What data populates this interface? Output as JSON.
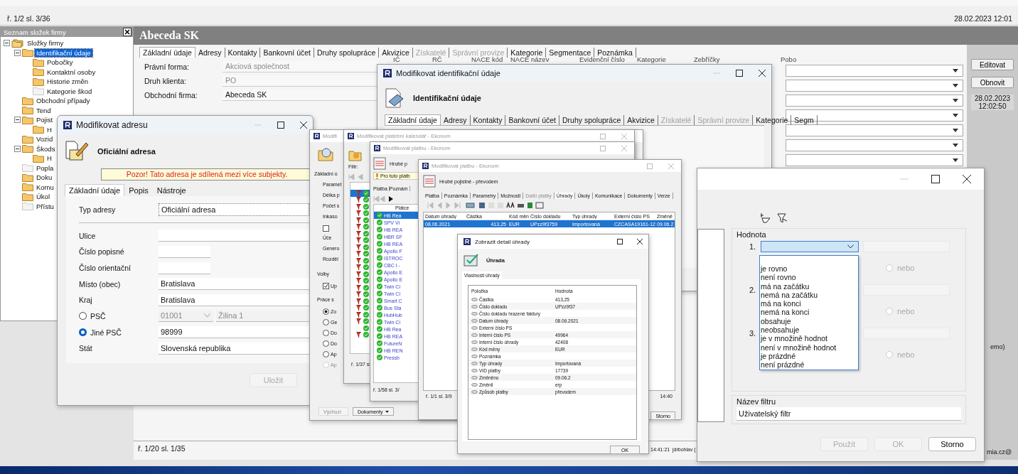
{
  "topbar": {
    "status": "ř. 1/2 sl. 3/36",
    "datetime": "28.02.2023 12:01"
  },
  "folder_panel": {
    "title": "Seznam složek firmy",
    "tree": [
      {
        "label": "Složky firmy",
        "kind": "root",
        "selected": false,
        "expanded": true,
        "children": [
          {
            "label": "Identifikační údaje",
            "kind": "folder",
            "selected": true,
            "expanded": true,
            "children": [
              {
                "label": "Pobočky",
                "kind": "folder",
                "selected": false
              },
              {
                "label": "Kontaktní osoby",
                "kind": "folder",
                "selected": false
              },
              {
                "label": "Historie změn",
                "kind": "folder",
                "selected": false
              },
              {
                "label": "Kategorie škod",
                "kind": "blank",
                "selected": false
              }
            ]
          },
          {
            "label": "Obchodní případy",
            "kind": "folder",
            "selected": false
          },
          {
            "label": "Tend",
            "kind": "folder",
            "selected": false
          },
          {
            "label": "Pojist",
            "kind": "folder",
            "selected": false,
            "expanded": true,
            "children": [
              {
                "label": "H",
                "kind": "folder",
                "selected": false
              }
            ]
          },
          {
            "label": "Vozid",
            "kind": "folder",
            "selected": false
          },
          {
            "label": "Škods",
            "kind": "folder",
            "selected": false,
            "expanded": true,
            "children": [
              {
                "label": "H",
                "kind": "folder",
                "selected": false
              }
            ]
          },
          {
            "label": "Popla",
            "kind": "blank",
            "selected": false
          },
          {
            "label": "Doku",
            "kind": "folder",
            "selected": false
          },
          {
            "label": "Komu",
            "kind": "folder",
            "selected": false
          },
          {
            "label": "Úkol",
            "kind": "folder",
            "selected": false
          },
          {
            "label": "Přístu",
            "kind": "blank",
            "selected": false
          }
        ]
      }
    ]
  },
  "company": {
    "title": "Abeceda SK",
    "tabs": [
      {
        "label": "Základní údaje",
        "selected": true,
        "disabled": false
      },
      {
        "label": "Adresy",
        "selected": false,
        "disabled": false
      },
      {
        "label": "Kontakty",
        "selected": false,
        "disabled": false
      },
      {
        "label": "Bankovní účet",
        "selected": false,
        "disabled": false
      },
      {
        "label": "Druhy spolupráce",
        "selected": false,
        "disabled": false
      },
      {
        "label": "Akvizice",
        "selected": false,
        "disabled": false
      },
      {
        "label": "Získatelé",
        "selected": false,
        "disabled": true
      },
      {
        "label": "Správní provize",
        "selected": false,
        "disabled": true
      },
      {
        "label": "Kategorie",
        "selected": false,
        "disabled": false
      },
      {
        "label": "Segmentace",
        "selected": false,
        "disabled": false
      },
      {
        "label": "Poznámka",
        "selected": false,
        "disabled": false
      }
    ],
    "fields": [
      {
        "label": "Právní forma:",
        "value": "Akciová společnost",
        "readonly": true
      },
      {
        "label": "Druh klienta:",
        "value": "PO",
        "readonly": true
      },
      {
        "label": "Obchodní firma:",
        "value": "Abeceda SK",
        "readonly": false
      }
    ],
    "grid_columns": [
      "IČ",
      "RČ",
      "NACE kód",
      "NACE název",
      "Evidenční číslo",
      "Kategorie",
      "Zebříčky",
      "Pobo"
    ],
    "buttons": [
      "Editovat",
      "Obnovit"
    ],
    "timestamp": "28.02.2023 12:02:50",
    "status": "ř. 1/20 sl. 1/35"
  },
  "identification_dialog": {
    "title": "Modifikovat identifikační údaje",
    "heading": "Identifikační údaje",
    "tabs": [
      {
        "label": "Základní údaje",
        "selected": true,
        "disabled": false
      },
      {
        "label": "Adresy",
        "selected": false,
        "disabled": false
      },
      {
        "label": "Kontakty",
        "selected": false,
        "disabled": false
      },
      {
        "label": "Bankovní účet",
        "selected": false,
        "disabled": false
      },
      {
        "label": "Druhy spolupráce",
        "selected": false,
        "disabled": false
      },
      {
        "label": "Akvizice",
        "selected": false,
        "disabled": false
      },
      {
        "label": "Získatelé",
        "selected": false,
        "disabled": true
      },
      {
        "label": "Správní provize",
        "selected": false,
        "disabled": true
      },
      {
        "label": "Kategorie",
        "selected": false,
        "disabled": false
      },
      {
        "label": "Segm",
        "selected": false,
        "disabled": false
      }
    ]
  },
  "address_dialog": {
    "title": "Modifikovat adresu",
    "heading": "Oficiální adresa",
    "warning": "Pozor! Tato adresa je sdílená mezi více subjekty.",
    "tabs": [
      {
        "label": "Základní údaje",
        "selected": true
      },
      {
        "label": "Popis",
        "selected": false
      },
      {
        "label": "Nástroje",
        "selected": false
      }
    ],
    "type_label": "Typ adresy",
    "type_value": "Oficiální adresa",
    "fields": [
      {
        "label": "Ulice",
        "kind": "wide"
      },
      {
        "label": "Číslo popisné",
        "kind": "short"
      },
      {
        "label": "Číslo orientační",
        "kind": "short"
      },
      {
        "label": "Místo (obec)",
        "kind": "wide",
        "value": "Bratislava"
      },
      {
        "label": "Kraj",
        "kind": "wide",
        "value": "Bratislava"
      }
    ],
    "postcodes": [
      {
        "label": "PSČ",
        "selected": false,
        "value": "01001",
        "city": "Žilina 1"
      },
      {
        "label": "Jiné PSČ",
        "selected": true,
        "value": "98999"
      }
    ],
    "country_label": "Stát",
    "country_value": "Slovenská republika",
    "save_button": "Uložit"
  },
  "window_a": {
    "title": "Modifi",
    "tab": "Základní ú",
    "rows": [
      {
        "kind": "label",
        "text": "Paramet"
      },
      {
        "kind": "label",
        "text": "Délka p"
      },
      {
        "kind": "label",
        "text": "Počet s"
      },
      {
        "kind": "label",
        "text": "Inkaso"
      },
      {
        "kind": "checkbox",
        "checked": false
      },
      {
        "kind": "label",
        "text": "Úče"
      },
      {
        "kind": "label",
        "text": "Genero"
      },
      {
        "kind": "label",
        "text": "Rozděl"
      },
      {
        "kind": "heading",
        "text": "Volby"
      },
      {
        "kind": "checkbox",
        "checked": true,
        "text": "Up"
      },
      {
        "kind": "heading",
        "text": "Práce s"
      },
      {
        "kind": "radio",
        "selected": true,
        "text": "Zo",
        "disabled": false
      },
      {
        "kind": "radio",
        "selected": false,
        "text": "Ge",
        "disabled": false
      },
      {
        "kind": "radio",
        "selected": false,
        "text": "Do",
        "disabled": false
      },
      {
        "kind": "radio",
        "selected": false,
        "text": "Do",
        "disabled": false
      },
      {
        "kind": "radio",
        "selected": false,
        "text": "Ap",
        "disabled": false
      },
      {
        "kind": "radio",
        "selected": false,
        "text": "Ap",
        "disabled": true
      }
    ],
    "buttons": [
      {
        "label": "Výchozí",
        "disabled": true
      },
      {
        "label": "Dokumenty",
        "disabled": false
      }
    ]
  },
  "window_b": {
    "title": "Modifikovat platební kalendář - Ekonom",
    "filter_label": "Filtr:",
    "status": "ř. 1/37 sl",
    "rows": [
      {
        "flagged": true,
        "selected": true
      },
      {
        "flagged": true,
        "selected": false
      },
      {
        "flagged": true,
        "selected": false
      },
      {
        "flagged": true,
        "selected": false
      },
      {
        "flagged": true,
        "selected": false
      },
      {
        "flagged": true,
        "selected": false
      },
      {
        "flagged": true,
        "selected": false
      },
      {
        "flagged": true,
        "selected": false
      },
      {
        "flagged": true,
        "selected": false
      },
      {
        "flagged": true,
        "selected": false
      },
      {
        "flagged": true,
        "selected": false
      },
      {
        "flagged": true,
        "selected": false
      },
      {
        "flagged": true,
        "selected": false
      },
      {
        "flagged": true,
        "selected": false
      },
      {
        "flagged": true,
        "selected": false
      },
      {
        "flagged": true,
        "selected": false
      },
      {
        "flagged": true,
        "selected": false
      },
      {
        "flagged": true,
        "selected": false
      },
      {
        "flagged": true,
        "selected": false
      },
      {
        "flagged": true,
        "selected": false
      },
      {
        "flagged": false,
        "selected": false
      },
      {
        "flagged": true,
        "selected": false
      }
    ]
  },
  "window_c": {
    "title": "Modifikovat platbu - Ekonom",
    "heading": "Hrubé p",
    "notice": "Pro tuto platb",
    "tabs": [
      "Platba",
      "Poznám"
    ],
    "column": "Plátce",
    "status": "ř. 1/58 sl. 3/",
    "rows": [
      {
        "payer": "HB Rea",
        "selected": true
      },
      {
        "payer": "SPV Vi",
        "selected": false
      },
      {
        "payer": "HB REA",
        "selected": false
      },
      {
        "payer": "HBR SF",
        "selected": false
      },
      {
        "payer": "HB REA",
        "selected": false
      },
      {
        "payer": "Apollo F",
        "selected": false
      },
      {
        "payer": "ISTROC",
        "selected": false
      },
      {
        "payer": "CBC I -",
        "selected": false
      },
      {
        "payer": "Apollo E",
        "selected": false
      },
      {
        "payer": "Apollo E",
        "selected": false
      },
      {
        "payer": "Twin Ci",
        "selected": false
      },
      {
        "payer": "Twin Ci",
        "selected": false
      },
      {
        "payer": "Smart C",
        "selected": false
      },
      {
        "payer": "Bus Sta",
        "selected": false
      },
      {
        "payer": "HubHub",
        "selected": false
      },
      {
        "payer": "Twin Ci",
        "selected": false
      },
      {
        "payer": "HB Rea",
        "selected": false
      },
      {
        "payer": "HB REA",
        "selected": false
      },
      {
        "payer": "FutureN",
        "selected": false
      },
      {
        "payer": "HB REN",
        "selected": false
      },
      {
        "payer": "Pressb",
        "selected": false
      }
    ]
  },
  "window_d": {
    "title": "Modifikovat platbu - Ekonom",
    "heading": "Hrubé pojistné - převodem",
    "tabs": [
      {
        "label": "Platba",
        "selected": false,
        "disabled": false
      },
      {
        "label": "Poznámka",
        "selected": false,
        "disabled": false
      },
      {
        "label": "Parametry",
        "selected": false,
        "disabled": false
      },
      {
        "label": "Možnosti",
        "selected": false,
        "disabled": false
      },
      {
        "label": "Další platby",
        "selected": false,
        "disabled": true
      },
      {
        "label": "Úhrady",
        "selected": true,
        "disabled": false
      },
      {
        "label": "Úkoly",
        "selected": false,
        "disabled": false
      },
      {
        "label": "Komunikace",
        "selected": false,
        "disabled": false
      },
      {
        "label": "Dokumenty",
        "selected": false,
        "disabled": false
      },
      {
        "label": "Verze",
        "selected": false,
        "disabled": false
      }
    ],
    "columns": [
      "Datum úhrady",
      "Částka",
      "Kód měn",
      "Číslo dokladu",
      "Typ úhrady",
      "Externí číslo PS",
      "Změně"
    ],
    "rows": [
      {
        "selected": true,
        "cells": [
          "08.06.2021",
          "413,25",
          "EUR",
          "UPzz9f3759",
          "Importovaná",
          "CZCASA19161-12",
          "09.06.2"
        ]
      }
    ],
    "status": "ř. 1/1 sl. 3/9",
    "time": "14:40",
    "cancel_button": "Storno"
  },
  "payment_detail": {
    "title": "Zobrazit detail úhrady",
    "heading": "Úhrada",
    "tab": "Vlastnosti úhrady",
    "columns": [
      "Položka",
      "Hodnota"
    ],
    "rows": [
      {
        "item": "Částka",
        "value": "413,25"
      },
      {
        "item": "Číslo dokladu",
        "value": "UPzz9f37"
      },
      {
        "item": "Číslo dokladu hrazené faktury"
      },
      {
        "item": "Datum úhrady",
        "value": "08.06.2021"
      },
      {
        "item": "Externí číslo PS"
      },
      {
        "item": "Interní číslo PS",
        "value": "49964"
      },
      {
        "item": "Interní číslo úhrady",
        "value": "42408"
      },
      {
        "item": "Kód měny",
        "value": "EUR"
      },
      {
        "item": "Poznámka"
      },
      {
        "item": "Typ úhrady",
        "value": "Importovaná"
      },
      {
        "item": "VID platby",
        "value": "17739"
      },
      {
        "item": "Změněno",
        "value": "09.06.2"
      },
      {
        "item": "Změnil",
        "value": "erp"
      },
      {
        "item": "Způsob platby",
        "value": "převodem"
      }
    ],
    "ok_button": "OK"
  },
  "background_log": {
    "time": "14:41:21",
    "user": "jdrbohlav (",
    "column_label": "emo)",
    "email": "mia.cz@"
  },
  "filter_dialog": {
    "value_group": "Hodnota",
    "conditions": [
      {
        "number": "1.",
        "or_label": "nebo",
        "selected": false
      },
      {
        "number": "2.",
        "or_label": "nebo",
        "selected": false
      },
      {
        "number": "3.",
        "or_label": "nebo",
        "selected": false
      }
    ],
    "operator_options": [
      "je rovno",
      "není rovno",
      "má na začátku",
      "nemá na začátku",
      "má na konci",
      "nemá na konci",
      "obsahuje",
      "neobsahuje",
      "je v množině hodnot",
      "není v množině hodnot",
      "je prázdné",
      "není prázdné"
    ],
    "name_group": "Název filtru",
    "name_value": "Uživatelský filtr",
    "buttons": [
      {
        "label": "Použít",
        "disabled": true
      },
      {
        "label": "OK",
        "disabled": true
      },
      {
        "label": "Storno",
        "disabled": false
      }
    ]
  }
}
